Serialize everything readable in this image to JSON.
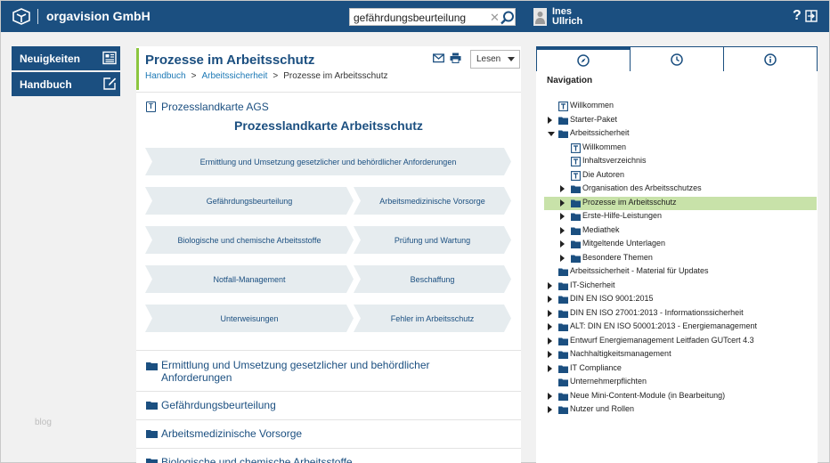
{
  "header": {
    "brand": "orgavision GmbH",
    "search_value": "gefährdungsbeurteilung",
    "user_first": "Ines",
    "user_last": "Ullrich",
    "help": "?",
    "brand_color": "#1b4f80"
  },
  "leftnav": {
    "items": [
      {
        "label": "Neuigkeiten",
        "icon": "newspaper-icon"
      },
      {
        "label": "Handbuch",
        "icon": "edit-icon"
      }
    ],
    "blog": "blog"
  },
  "main": {
    "title": "Prozesse im Arbeitsschutz",
    "breadcrumb": [
      "Handbuch",
      "Arbeitssicherheit",
      "Prozesse im Arbeitsschutz"
    ],
    "read_select": "Lesen",
    "section_title": "Prozesslandkarte AGS",
    "map_title": "Prozesslandkarte Arbeitsschutz",
    "chevrons": [
      "Ermittlung und Umsetzung gesetzlicher und behördlicher Anforderungen",
      "Gefährdungsbeurteilung",
      "Arbeitsmedizinische Vorsorge",
      "Biologische und chemische Arbeitsstoffe",
      "Prüfung und Wartung",
      "Notfall-Management",
      "Beschaffung",
      "Unterweisungen",
      "Fehler im Arbeitsschutz"
    ],
    "list": [
      "Ermittlung und Umsetzung gesetzlicher und behördlicher Anforderungen",
      "Gefährdungsbeurteilung",
      "Arbeitsmedizinische Vorsorge",
      "Biologische und chemische Arbeitsstoffe"
    ]
  },
  "right": {
    "tabs": [
      "compass-icon",
      "clock-icon",
      "info-icon"
    ],
    "nav_title": "Navigation",
    "tree": [
      {
        "label": "Willkommen",
        "type": "doc",
        "level": 0,
        "toggle": "none"
      },
      {
        "label": "Starter-Paket",
        "type": "folder",
        "level": 0,
        "toggle": "right"
      },
      {
        "label": "Arbeitssicherheit",
        "type": "folder",
        "level": 0,
        "toggle": "down"
      },
      {
        "label": "Willkommen",
        "type": "doc",
        "level": 1,
        "toggle": "none"
      },
      {
        "label": "Inhaltsverzeichnis",
        "type": "doc",
        "level": 1,
        "toggle": "none"
      },
      {
        "label": "Die Autoren",
        "type": "doc",
        "level": 1,
        "toggle": "none"
      },
      {
        "label": "Organisation des Arbeitsschutzes",
        "type": "folder",
        "level": 1,
        "toggle": "right"
      },
      {
        "label": "Prozesse im Arbeitsschutz",
        "type": "folder",
        "level": 1,
        "toggle": "right",
        "selected": true
      },
      {
        "label": "Erste-Hilfe-Leistungen",
        "type": "folder",
        "level": 1,
        "toggle": "right"
      },
      {
        "label": "Mediathek",
        "type": "folder",
        "level": 1,
        "toggle": "right"
      },
      {
        "label": "Mitgeltende Unterlagen",
        "type": "folder",
        "level": 1,
        "toggle": "right"
      },
      {
        "label": "Besondere Themen",
        "type": "folder",
        "level": 1,
        "toggle": "right"
      },
      {
        "label": "Arbeitssicherheit - Material für Updates",
        "type": "folder",
        "level": 0,
        "toggle": "none"
      },
      {
        "label": "IT-Sicherheit",
        "type": "folder",
        "level": 0,
        "toggle": "right"
      },
      {
        "label": "DIN EN ISO 9001:2015",
        "type": "folder",
        "level": 0,
        "toggle": "right"
      },
      {
        "label": "DIN EN ISO 27001:2013 - Informationssicherheit",
        "type": "folder",
        "level": 0,
        "toggle": "right"
      },
      {
        "label": "ALT: DIN EN ISO 50001:2013 - Energiemanagement",
        "type": "folder",
        "level": 0,
        "toggle": "right"
      },
      {
        "label": "Entwurf Energiemanagement Leitfaden GUTcert 4.3",
        "type": "folder",
        "level": 0,
        "toggle": "right"
      },
      {
        "label": "Nachhaltigkeitsmanagement",
        "type": "folder",
        "level": 0,
        "toggle": "right"
      },
      {
        "label": "IT Compliance",
        "type": "folder",
        "level": 0,
        "toggle": "right"
      },
      {
        "label": "Unternehmerpflichten",
        "type": "folder",
        "level": 0,
        "toggle": "none"
      },
      {
        "label": "Neue Mini-Content-Module (in Bearbeitung)",
        "type": "folder",
        "level": 0,
        "toggle": "right"
      },
      {
        "label": "Nutzer und Rollen",
        "type": "folder",
        "level": 0,
        "toggle": "right"
      }
    ],
    "highlight_color": "#c8e2a9"
  }
}
